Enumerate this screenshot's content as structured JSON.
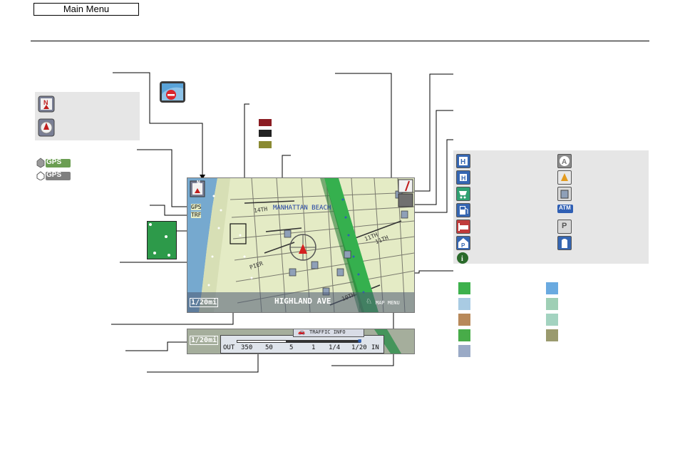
{
  "header": {
    "main_menu": "Main Menu"
  },
  "map": {
    "place_label": "MANHATTAN BEACH",
    "street_current": "HIGHLAND AVE",
    "map_menu": "MAP MENU",
    "scale": "1/20mi",
    "gps": "GPS",
    "trf": "TRF",
    "street_14th": "14TH",
    "street_11th_a": "11TH",
    "street_11th_b": "11TH",
    "street_10th": "10TH",
    "street_pier": "PIER"
  },
  "traffic_bar": {
    "scale": "1/20mi",
    "title": "TRAFFIC INFO",
    "out": "OUT",
    "ticks": [
      "350",
      "50",
      "5",
      "1",
      "1/4",
      "1/20"
    ],
    "in": "IN"
  },
  "legend_gps": {
    "label1": "GPS",
    "label2": "GPS"
  },
  "poi_icons": [
    "ATM",
    "P"
  ],
  "colors": {
    "traffic_red": "#8b1c22",
    "traffic_black": "#222222",
    "traffic_olive": "#8a8a32",
    "land_yellow": "#e4ebc5",
    "water_blue": "#76a9cf",
    "road_green": "#35b04e",
    "swatches": [
      "#3db14c",
      "#6aaae0",
      "#a9cbe3",
      "#9fcfb5",
      "#b8895a",
      "#a3d3c0",
      "#48ac49",
      "#9a9a6e",
      "#9aaac6"
    ]
  }
}
